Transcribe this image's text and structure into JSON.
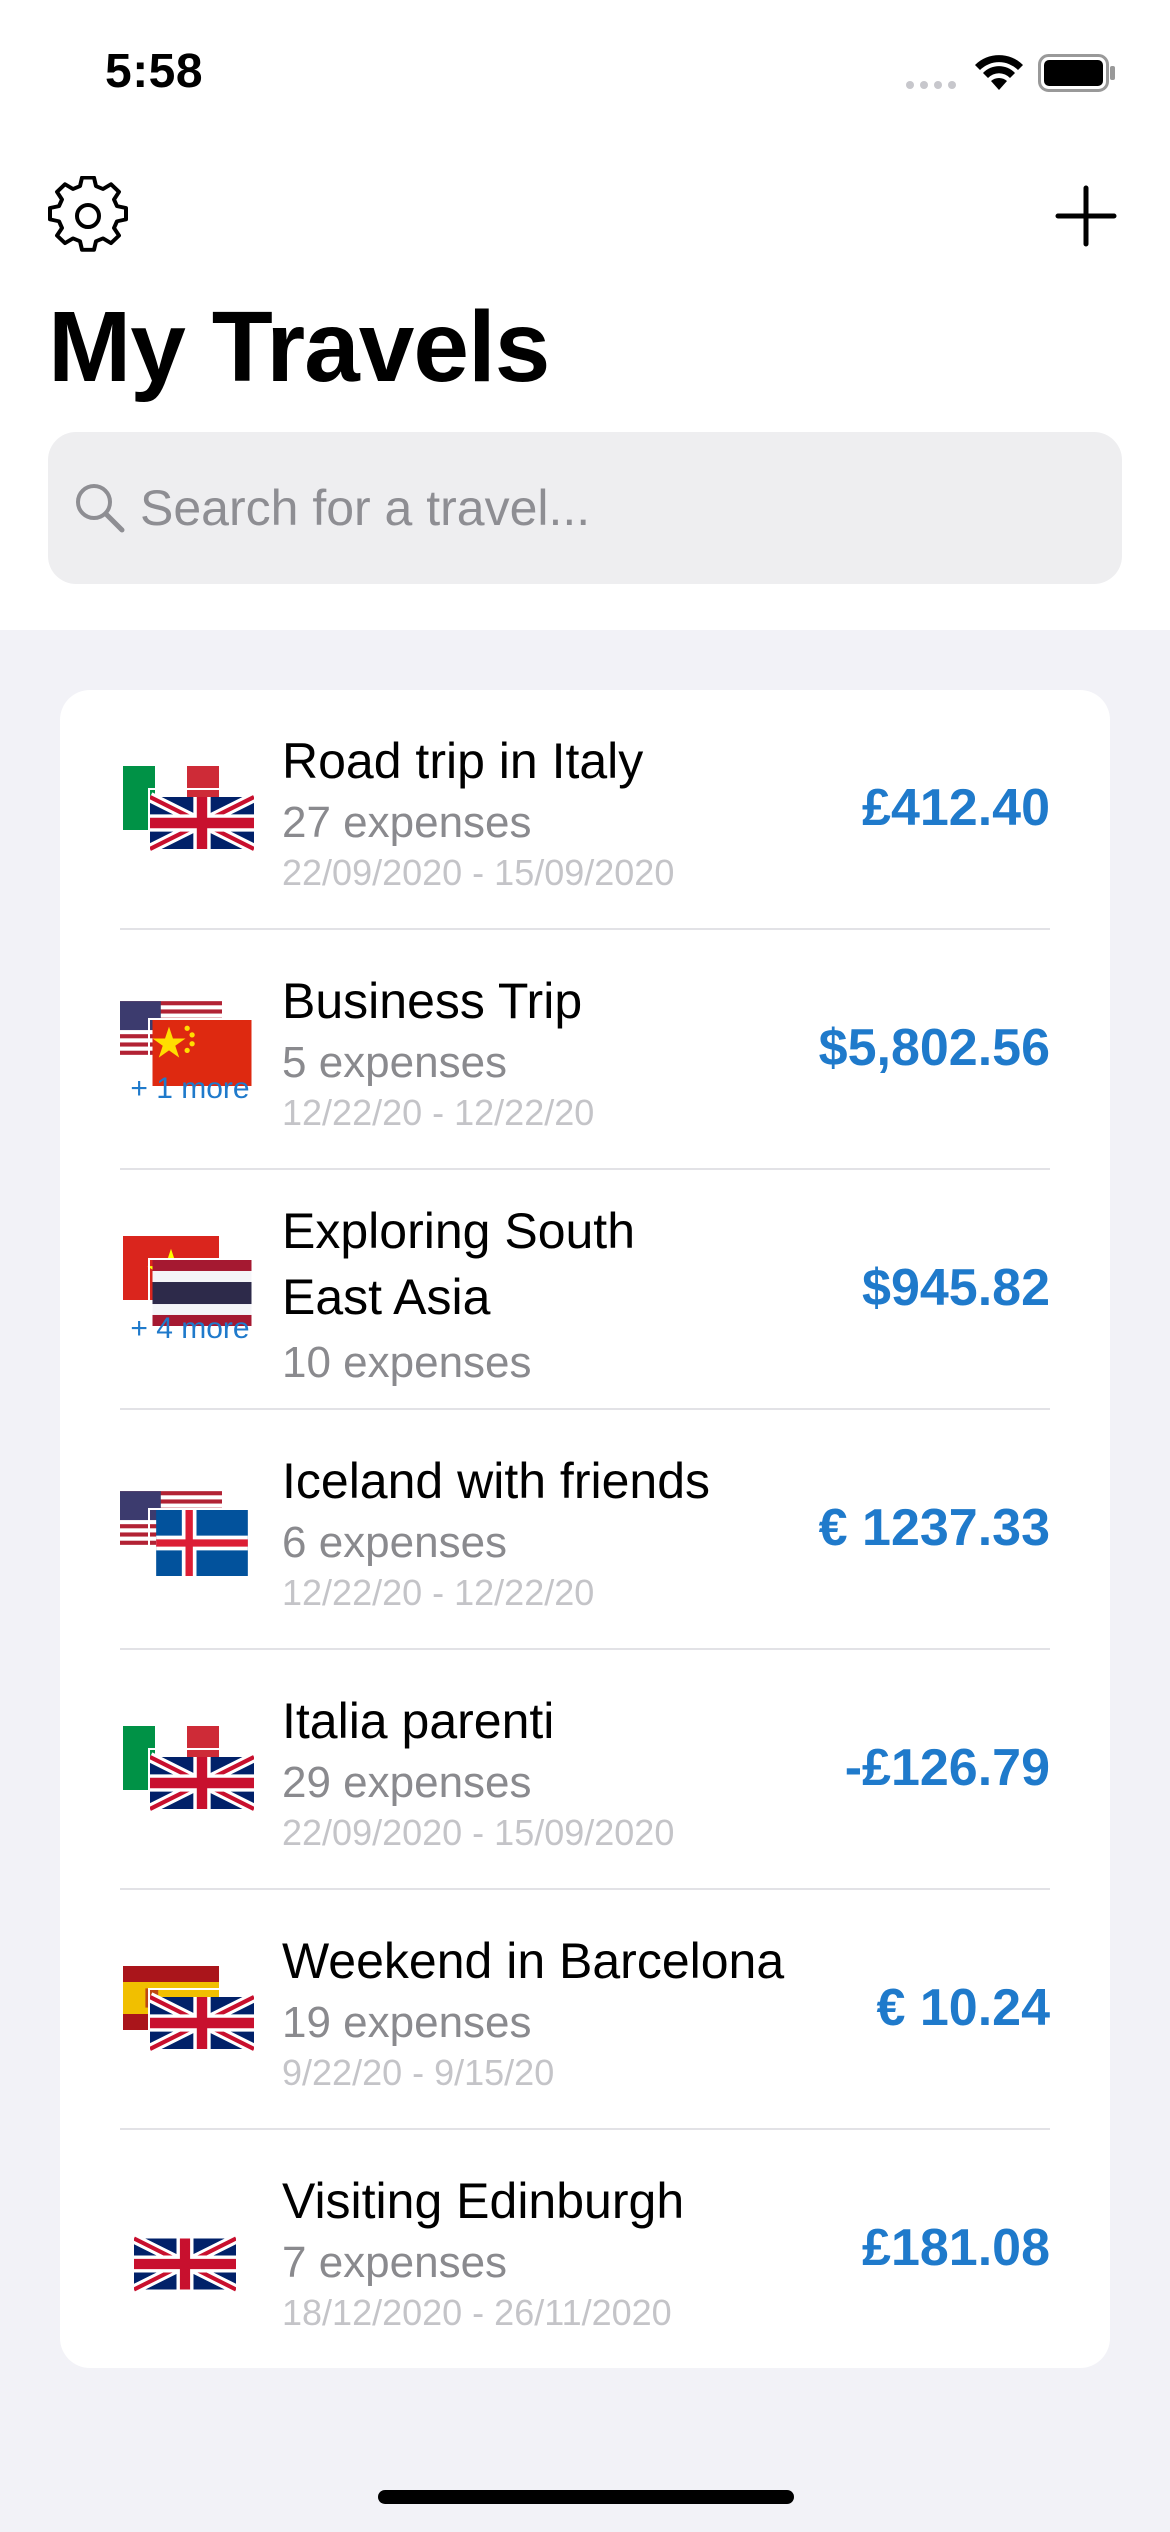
{
  "status": {
    "time": "5:58"
  },
  "header": {
    "title": "My Travels",
    "settings_icon": "gear-icon",
    "add_icon": "plus-icon"
  },
  "search": {
    "placeholder": "Search for a travel..."
  },
  "colors": {
    "accent": "#1f7acb",
    "background": "#f2f2f7",
    "secondary_text": "#8a8a8e",
    "tertiary_text": "#c4c4c8"
  },
  "travels": [
    {
      "title": "Road trip in Italy",
      "expenses": "27 expenses",
      "dates": "22/09/2020 - 15/09/2020",
      "amount": "£412.40",
      "flags": [
        "italy",
        "uk"
      ]
    },
    {
      "title": "Business Trip",
      "expenses": "5 expenses",
      "dates": "12/22/20 - 12/22/20",
      "amount": "$5,802.56",
      "flags": [
        "usa",
        "china"
      ],
      "more": "+ 1 more"
    },
    {
      "title_line1": "Exploring South",
      "title_line2": "East Asia",
      "expenses": "10 expenses",
      "amount": "$945.82",
      "flags": [
        "vietnam",
        "thailand"
      ],
      "more": "+ 4 more"
    },
    {
      "title": "Iceland with friends",
      "expenses": "6 expenses",
      "dates": "12/22/20 - 12/22/20",
      "amount": "€ 1237.33",
      "flags": [
        "usa",
        "iceland"
      ]
    },
    {
      "title": "Italia parenti",
      "expenses": "29 expenses",
      "dates": "22/09/2020 - 15/09/2020",
      "amount": "-£126.79",
      "flags": [
        "italy",
        "uk"
      ]
    },
    {
      "title": "Weekend in Barcelona",
      "expenses": "19 expenses",
      "dates": "9/22/20 - 9/15/20",
      "amount": "€ 10.24",
      "flags": [
        "spain",
        "uk"
      ]
    },
    {
      "title": "Visiting Edinburgh",
      "expenses": "7 expenses",
      "dates": "18/12/2020 - 26/11/2020",
      "amount": "£181.08",
      "flags": [
        "uk"
      ]
    }
  ]
}
